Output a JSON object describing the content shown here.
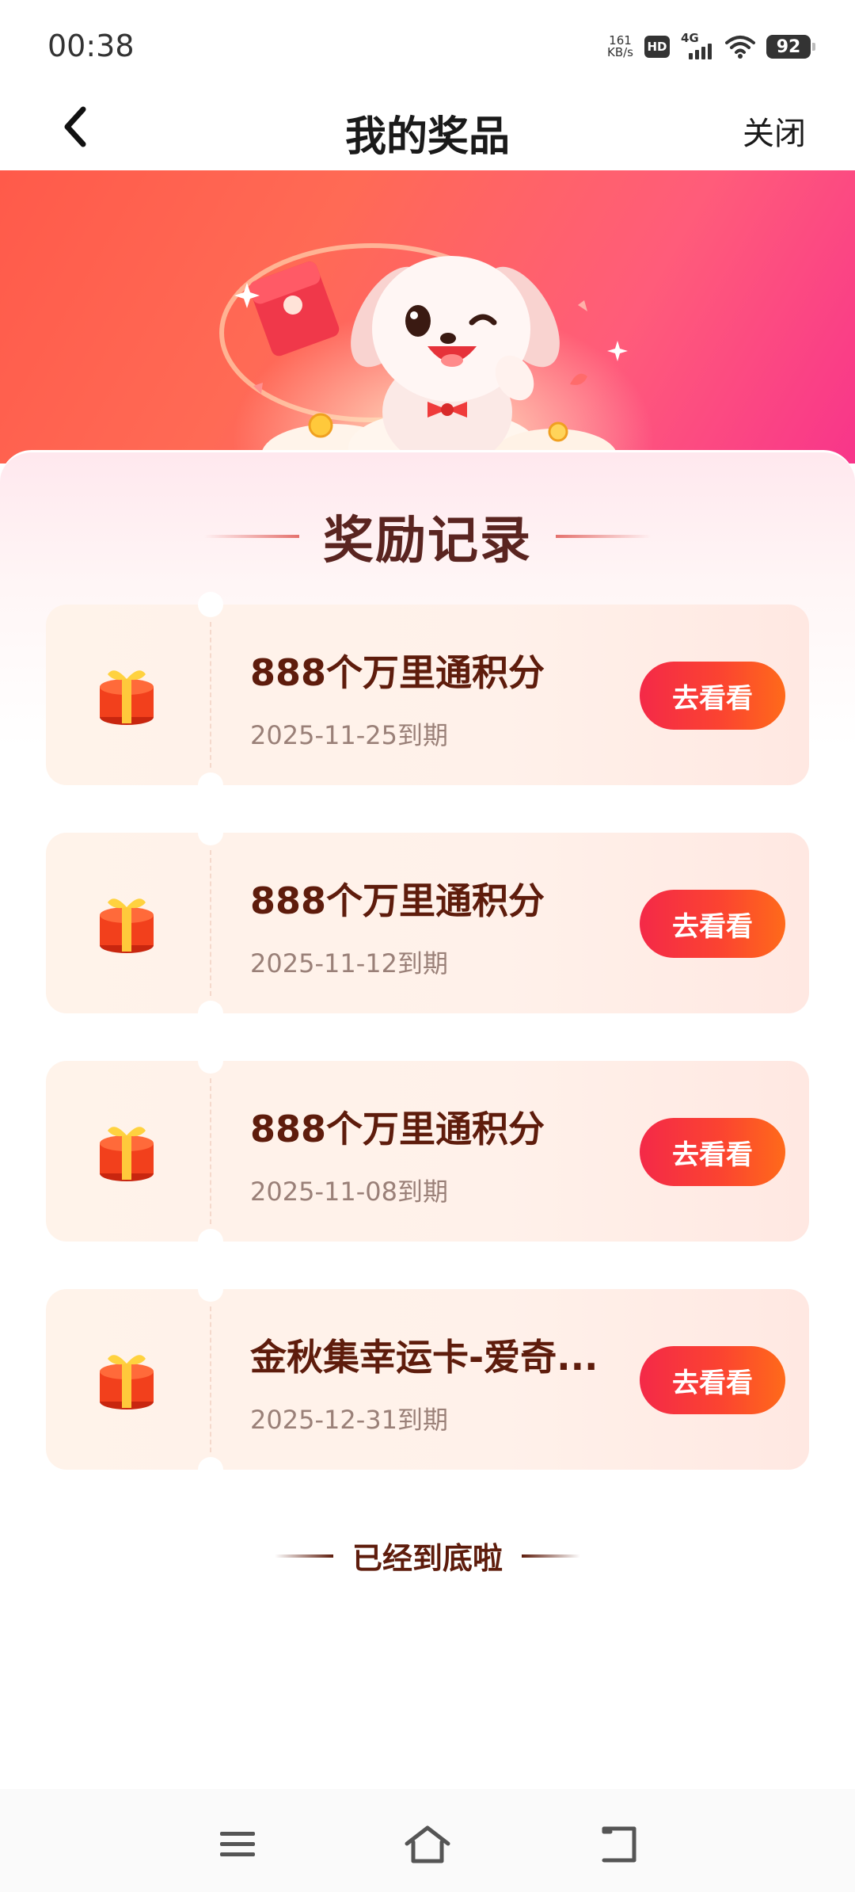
{
  "status_bar": {
    "time": "00:38",
    "net_speed_value": "161",
    "net_speed_unit": "KB/s",
    "hd_label": "HD",
    "network_gen": "4G",
    "battery": "92"
  },
  "nav": {
    "title": "我的奖品",
    "close_label": "关闭"
  },
  "section": {
    "title": "奖励记录"
  },
  "rewards": [
    {
      "name": "888个万里通积分",
      "expire": "2025-11-25到期",
      "button": "去看看"
    },
    {
      "name": "888个万里通积分",
      "expire": "2025-11-12到期",
      "button": "去看看"
    },
    {
      "name": "888个万里通积分",
      "expire": "2025-11-08到期",
      "button": "去看看"
    },
    {
      "name": "金秋集幸运卡-爱奇...",
      "expire": "2025-12-31到期",
      "button": "去看看"
    }
  ],
  "end_tip": "已经到底啦",
  "colors": {
    "button_gradient_start": "#f42948",
    "button_gradient_end": "#ff6a1a",
    "reward_name": "#5e1c0c",
    "section_title": "#5a2420"
  },
  "icons": [
    "back-arrow-icon",
    "gift-box-icon",
    "menu-icon",
    "home-icon",
    "back-icon"
  ]
}
